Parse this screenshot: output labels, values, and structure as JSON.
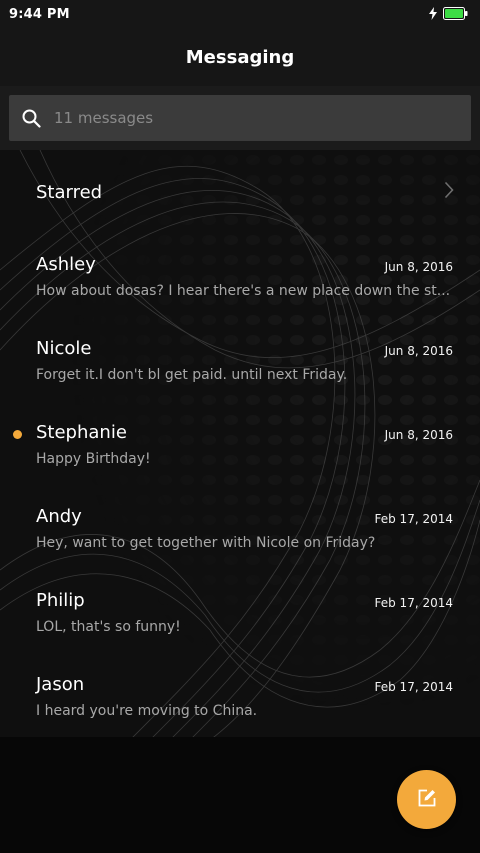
{
  "status_bar": {
    "time": "9:44 PM",
    "battery_color": "#3ddc45"
  },
  "header": {
    "title": "Messaging"
  },
  "search": {
    "placeholder": "11 messages"
  },
  "starred": {
    "label": "Starred"
  },
  "conversations": [
    {
      "name": "Ashley",
      "date": "Jun 8, 2016",
      "preview": "How about dosas? I hear there's a new place down the st...",
      "unread": false
    },
    {
      "name": "Nicole",
      "date": "Jun 8, 2016",
      "preview": "Forget it.I don't bl get paid. until next Friday.",
      "unread": false
    },
    {
      "name": "Stephanie",
      "date": "Jun 8, 2016",
      "preview": "Happy Birthday!",
      "unread": true
    },
    {
      "name": "Andy",
      "date": "Feb 17, 2014",
      "preview": "Hey, want to get together with Nicole on Friday?",
      "unread": false
    },
    {
      "name": "Philip",
      "date": "Feb 17, 2014",
      "preview": "LOL, that's so funny!",
      "unread": false
    },
    {
      "name": "Jason",
      "date": "Feb 17, 2014",
      "preview": "I heard you're moving to China.",
      "unread": false
    }
  ],
  "icons": {
    "search": "search-icon",
    "chevron": "chevron-right-icon",
    "compose": "compose-icon",
    "charging": "charging-bolt-icon",
    "battery": "battery-icon"
  },
  "colors": {
    "accent": "#f3a93b",
    "unread_dot": "#f3a93b"
  }
}
